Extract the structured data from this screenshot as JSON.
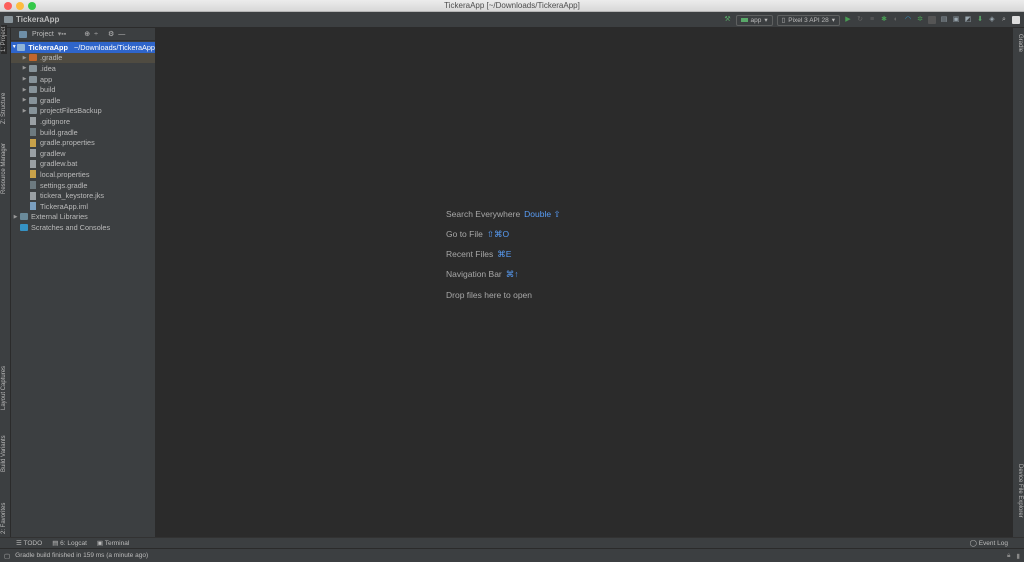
{
  "window": {
    "title": "TickeraApp [~/Downloads/TickeraApp]"
  },
  "navbar": {
    "project": "TickeraApp"
  },
  "toolbar": {
    "run_config": "app",
    "device": "Pixel 3 API 28"
  },
  "left_tabs": [
    "1: Project",
    "Z: Structure",
    "Resource Manager",
    "Layout Captures",
    "Build Variants",
    "2: Favorites"
  ],
  "right_tabs": [
    "Gradle",
    "Device File Explorer"
  ],
  "project_panel": {
    "view": "Project",
    "root": {
      "name": "TickeraApp",
      "path": "~/Downloads/TickeraApp"
    },
    "items": [
      {
        "name": ".gradle",
        "type": "folder-orange"
      },
      {
        "name": ".idea",
        "type": "folder"
      },
      {
        "name": "app",
        "type": "folder"
      },
      {
        "name": "build",
        "type": "folder"
      },
      {
        "name": "gradle",
        "type": "folder"
      },
      {
        "name": "projectFilesBackup",
        "type": "folder"
      },
      {
        "name": ".gitignore",
        "type": "file"
      },
      {
        "name": "build.gradle",
        "type": "gradle"
      },
      {
        "name": "gradle.properties",
        "type": "properties"
      },
      {
        "name": "gradlew",
        "type": "file"
      },
      {
        "name": "gradlew.bat",
        "type": "file"
      },
      {
        "name": "local.properties",
        "type": "properties"
      },
      {
        "name": "settings.gradle",
        "type": "gradle"
      },
      {
        "name": "tickera_keystore.jks",
        "type": "file"
      },
      {
        "name": "TickeraApp.iml",
        "type": "iml"
      }
    ],
    "external": "External Libraries",
    "scratches": "Scratches and Consoles"
  },
  "editor_hints": [
    {
      "label": "Search Everywhere",
      "shortcut": "Double ⇧"
    },
    {
      "label": "Go to File",
      "shortcut": "⇧⌘O"
    },
    {
      "label": "Recent Files",
      "shortcut": "⌘E"
    },
    {
      "label": "Navigation Bar",
      "shortcut": "⌘↑"
    },
    {
      "label": "Drop files here to open",
      "shortcut": ""
    }
  ],
  "bottom_tabs": {
    "todo": "TODO",
    "logcat": "6: Logcat",
    "terminal": "Terminal",
    "event_log": "Event Log"
  },
  "status": "Gradle build finished in 159 ms (a minute ago)"
}
